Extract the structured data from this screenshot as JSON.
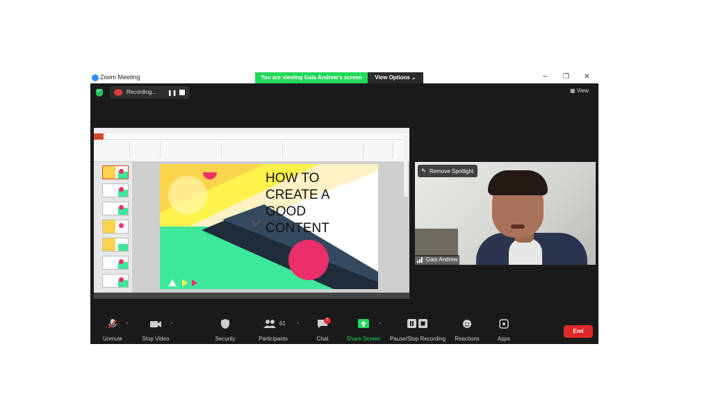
{
  "window": {
    "title": "Zoom Meeting"
  },
  "banner": {
    "text": "You are viewing Gais Andrew's screen",
    "view_options": "View Options"
  },
  "recording": {
    "label": "Recording..."
  },
  "view_button": "View",
  "slide": {
    "title_lines": [
      "HOW TO",
      "CREATE A",
      "GOOD",
      "CONTENT"
    ]
  },
  "video": {
    "spotlight_label": "Remove Spotlight",
    "participant_name": "Gais Andrew"
  },
  "toolbar": {
    "unmute": "Unmute",
    "stop_video": "Stop Video",
    "security": "Security",
    "participants": "Participants",
    "participants_count": "61",
    "chat": "Chat",
    "chat_badge": "7",
    "share_screen": "Share Screen",
    "pause_stop_recording": "Pause/Stop Recording",
    "reactions": "Reactions",
    "apps": "Apps",
    "end": "End"
  },
  "colors": {
    "banner_green": "#23d959",
    "end_red": "#e02828",
    "share_green": "#23d959",
    "slide_yellow": "#fff24a",
    "slide_pink": "#ec2f6b",
    "slide_green": "#3ee89a",
    "slide_navy": "#1f2d3b"
  },
  "icons": [
    "app-icon",
    "shield-icon",
    "record-cloud-icon",
    "pause-icon",
    "stop-icon",
    "grid-view-icon",
    "pin-icon",
    "signal-icon",
    "mic-muted-icon",
    "video-camera-icon",
    "security-shield-icon",
    "participants-icon",
    "chat-icon",
    "share-screen-icon",
    "pause-stop-recording-icon",
    "reactions-icon",
    "apps-icon"
  ]
}
